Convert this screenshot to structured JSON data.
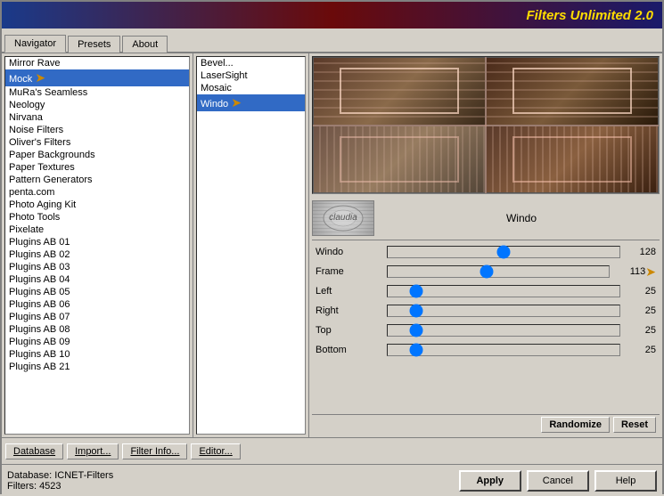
{
  "titleBar": {
    "text": "Filters Unlimited 2.0"
  },
  "tabs": [
    {
      "label": "Navigator",
      "active": true
    },
    {
      "label": "Presets",
      "active": false
    },
    {
      "label": "About",
      "active": false
    }
  ],
  "filterList": {
    "items": [
      "Mirror Rave",
      "Mock",
      "MuRa's Seamless",
      "Neology",
      "Nirvana",
      "Noise Filters",
      "Oliver's Filters",
      "Paper Backgrounds",
      "Paper Textures",
      "Pattern Generators",
      "penta.com",
      "Photo Aging Kit",
      "Photo Tools",
      "Pixelate",
      "Plugins AB 01",
      "Plugins AB 02",
      "Plugins AB 03",
      "Plugins AB 04",
      "Plugins AB 05",
      "Plugins AB 06",
      "Plugins AB 07",
      "Plugins AB 08",
      "Plugins AB 09",
      "Plugins AB 10",
      "Plugins AB 21"
    ],
    "selected": "Mock"
  },
  "subList": {
    "items": [
      "Bevel...",
      "LaserSight",
      "Mosaic",
      "Windo"
    ],
    "selected": "Windo"
  },
  "preview": {
    "filterName": "Windo",
    "logoText": "claudia"
  },
  "params": [
    {
      "label": "Windo",
      "value": 128,
      "min": 0,
      "max": 255,
      "sliderPos": 0.5
    },
    {
      "label": "Frame",
      "value": 113,
      "min": 0,
      "max": 255,
      "sliderPos": 0.44
    },
    {
      "label": "Left",
      "value": 25,
      "min": 0,
      "max": 255,
      "sliderPos": 0.1
    },
    {
      "label": "Right",
      "value": 25,
      "min": 0,
      "max": 255,
      "sliderPos": 0.1
    },
    {
      "label": "Top",
      "value": 25,
      "min": 0,
      "max": 255,
      "sliderPos": 0.1
    },
    {
      "label": "Bottom",
      "value": 25,
      "min": 0,
      "max": 255,
      "sliderPos": 0.1
    }
  ],
  "toolbar": {
    "database": "Database",
    "import": "Import...",
    "filterInfo": "Filter Info...",
    "editor": "Editor...",
    "randomize": "Randomize",
    "reset": "Reset"
  },
  "statusBar": {
    "dbLabel": "Database:",
    "dbValue": "ICNET-Filters",
    "filtersLabel": "Filters:",
    "filtersValue": "4523",
    "applyBtn": "Apply",
    "cancelBtn": "Cancel",
    "helpBtn": "Help"
  }
}
